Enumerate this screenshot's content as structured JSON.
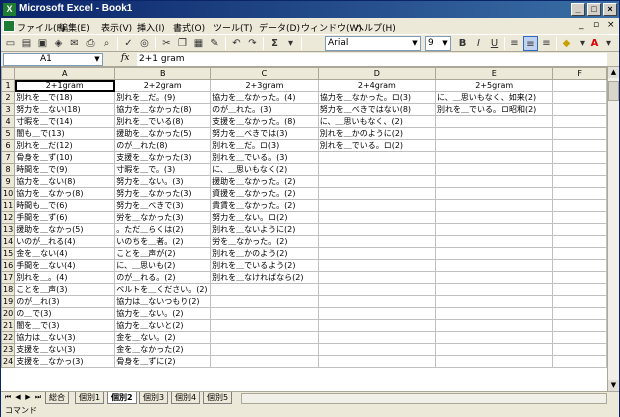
{
  "window": {
    "title": "Microsoft Excel - Book1",
    "app_icon": "excel-icon"
  },
  "menu": [
    "ファイル(F)",
    "編集(E)",
    "表示(V)",
    "挿入(I)",
    "書式(O)",
    "ツール(T)",
    "データ(D)",
    "ウィンドウ(W)",
    "ヘルプ(H)"
  ],
  "toolbar": {
    "font": "Arial",
    "size": "9",
    "bold": "B",
    "italic": "I",
    "underline": "U",
    "sum": "Σ"
  },
  "formula": {
    "cell_ref": "A1",
    "fx": "fx",
    "content": "2+1 gram"
  },
  "columns": [
    "A",
    "B",
    "C",
    "D",
    "E",
    "F"
  ],
  "rows": [
    [
      "2+1gram",
      "2+2gram",
      "2+3gram",
      "2+4gram",
      "2+5gram",
      ""
    ],
    [
      "別れを＿で(18)",
      "別れを＿だ。(9)",
      "協力を＿なかった。(4)",
      "協力を＿なかった。ロ(3)",
      "に、＿思いもなく、如来(2)",
      ""
    ],
    [
      "努力を＿ない(18)",
      "協力を＿なかった(8)",
      "のが＿れた。(3)",
      "努力を＿べきではない(8)",
      "別れを＿でいる。ロ昭和(2)",
      ""
    ],
    [
      "寸暇を＿で(14)",
      "別れを＿でいる(8)",
      "支援を＿なかった。(8)",
      "に、＿思いもなく、(2)",
      "",
      ""
    ],
    [
      "闇も＿で(13)",
      "援助を＿なかった(5)",
      "努力を＿べきでは(3)",
      "別れを＿かのように(2)",
      "",
      ""
    ],
    [
      "別れを＿だ(12)",
      "のが＿れた(8)",
      "別れを＿だ。ロ(3)",
      "別れを＿でいる。ロ(2)",
      "",
      ""
    ],
    [
      "骨身を＿ず(10)",
      "支援を＿なかった(3)",
      "別れを＿でいる。(3)",
      "",
      "",
      ""
    ],
    [
      "時間を＿で(9)",
      "寸暇を＿で。(3)",
      "に、＿思いもなく(2)",
      "",
      "",
      ""
    ],
    [
      "協力を＿ない(8)",
      "努力を＿ない。(3)",
      "援助を＿なかった。(2)",
      "",
      "",
      ""
    ],
    [
      "協力を＿なかっ(8)",
      "努力を＿なかった(3)",
      "資援を＿なかった。(2)",
      "",
      "",
      ""
    ],
    [
      "時間も＿で(6)",
      "努力を＿べきで(3)",
      "貴賃を＿なかった。(2)",
      "",
      "",
      ""
    ],
    [
      "手間を＿ず(6)",
      "労を＿なかった(3)",
      "努力を＿ない。ロ(2)",
      "",
      "",
      ""
    ],
    [
      "援助を＿なかっ(5)",
      "。ただ＿らくは(2)",
      "別れを＿ないように(2)",
      "",
      "",
      ""
    ],
    [
      "いのが＿れる(4)",
      "いのちを＿者。(2)",
      "労を＿なかった。(2)",
      "",
      "",
      ""
    ],
    [
      "金を＿ない(4)",
      "ことを＿声が(2)",
      "別れを＿かのよう(2)",
      "",
      "",
      ""
    ],
    [
      "手間を＿ない(4)",
      "に、＿思いも(2)",
      "別れを＿でいるよう(2)",
      "",
      "",
      ""
    ],
    [
      "別れを＿。(4)",
      "のが＿れる。(2)",
      "別れを＿なければなら(2)",
      "",
      "",
      ""
    ],
    [
      "ことを＿声(3)",
      "ベルトを＿ください。(2)",
      "",
      "",
      "",
      ""
    ],
    [
      "のが＿れ(3)",
      "協力は＿ないつもり(2)",
      "",
      "",
      "",
      ""
    ],
    [
      "の＿で(3)",
      "協力を＿ない。(2)",
      "",
      "",
      "",
      ""
    ],
    [
      "闇を＿で(3)",
      "協力を＿ないと(2)",
      "",
      "",
      "",
      ""
    ],
    [
      "協力は＿ない(3)",
      "金を＿ない。(2)",
      "",
      "",
      "",
      ""
    ],
    [
      "支援を＿ない(3)",
      "金を＿なかった(2)",
      "",
      "",
      "",
      ""
    ],
    [
      "支援を＿なかっ(3)",
      "骨身を＿ずに(2)",
      "",
      "",
      "",
      ""
    ]
  ],
  "tabs": [
    "総合",
    "個別1",
    "個別2",
    "個別3",
    "個別4",
    "個別5"
  ],
  "active_tab": "個別2",
  "status": "コマンド"
}
